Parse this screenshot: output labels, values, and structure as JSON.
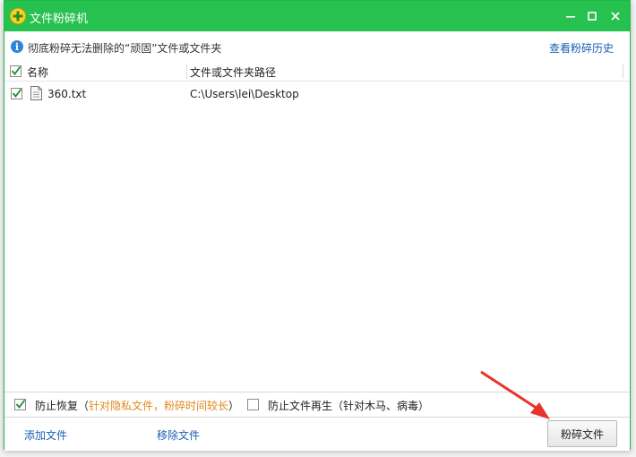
{
  "window": {
    "title": "文件粉碎机"
  },
  "info": {
    "text": "彻底粉碎无法删除的“顽固”文件或文件夹",
    "history_link": "查看粉碎历史"
  },
  "table": {
    "columns": [
      "名称",
      "文件或文件夹路径"
    ],
    "rows": [
      {
        "checked": true,
        "name": "360.txt",
        "path": "C:\\Users\\lei\\Desktop"
      }
    ]
  },
  "options": {
    "prevent_recovery": {
      "checked": true,
      "label": "防止恢复",
      "paren_open": "（",
      "note": "针对隐私文件，粉碎时间较长",
      "paren_close": "）"
    },
    "prevent_regen": {
      "checked": false,
      "label": "防止文件再生",
      "note": "（针对木马、病毒）"
    }
  },
  "footer": {
    "add_file": "添加文件",
    "remove_file": "移除文件",
    "shred_button": "粉碎文件"
  },
  "colors": {
    "titlebar": "#27c14f",
    "link": "#1a5fb4",
    "note": "#e08a1e",
    "arrow": "#e8322c"
  }
}
